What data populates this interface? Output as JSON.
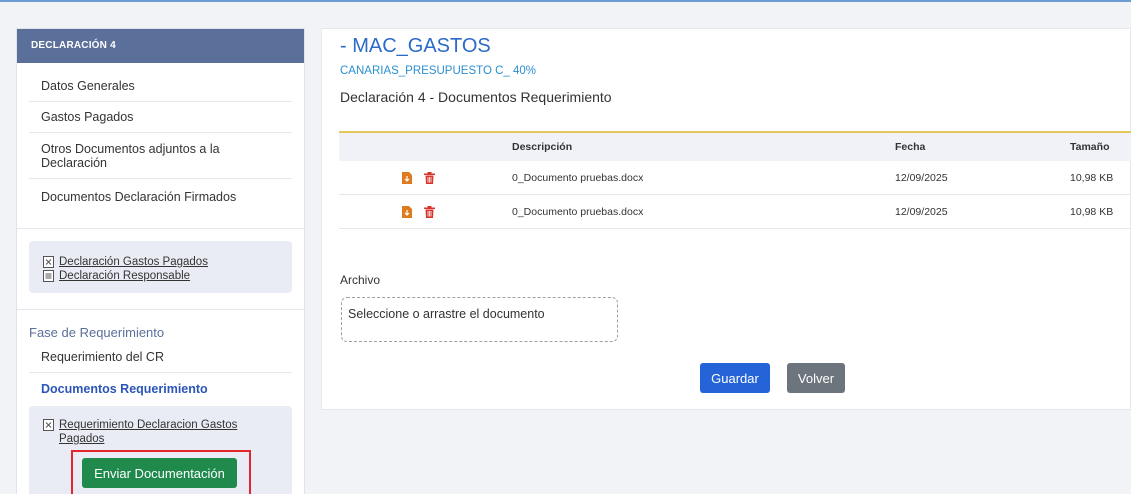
{
  "sidebar": {
    "header": "DECLARACIÓN 4",
    "items": [
      {
        "label": "Datos Generales"
      },
      {
        "label": "Gastos Pagados"
      },
      {
        "label": "Otros Documentos adjuntos a la Declaración"
      },
      {
        "label": "Documentos Declaración Firmados"
      }
    ],
    "links": [
      {
        "label": "Declaración Gastos Pagados",
        "icon": "excel-file-icon"
      },
      {
        "label": "Declaración Responsable",
        "icon": "document-file-icon"
      }
    ],
    "phase_title": "Fase de Requerimiento",
    "phase_items": [
      {
        "label": "Requerimiento del CR"
      },
      {
        "label": "Documentos Requerimiento"
      }
    ],
    "phase_link": {
      "label": "Requerimiento Declaracion Gastos Pagados",
      "icon": "excel-file-icon"
    },
    "send_button": "Enviar Documentación"
  },
  "main": {
    "title": "- MAC_GASTOS",
    "subtitle": "CANARIAS_PRESUPUESTO C_ 40%",
    "heading": "Declaración 4 - Documentos Requerimiento",
    "table": {
      "columns": [
        "Descripción",
        "Fecha",
        "Tamaño"
      ],
      "rows": [
        {
          "descripcion": "0_Documento pruebas.docx",
          "fecha": "12/09/2025",
          "tamano": "10,98 KB"
        },
        {
          "descripcion": "0_Documento pruebas.docx",
          "fecha": "12/09/2025",
          "tamano": "10,98 KB"
        }
      ]
    },
    "file_label": "Archivo",
    "dropzone_text": "Seleccione o arrastre el documento",
    "save_button": "Guardar",
    "back_button": "Volver"
  },
  "colors": {
    "accent": "#2b6bc7",
    "sidebar_header": "#5a6f9a",
    "download": "#e07a1f",
    "delete": "#d9342b",
    "send": "#1f8a4c",
    "highlight_frame": "#e3262b"
  }
}
